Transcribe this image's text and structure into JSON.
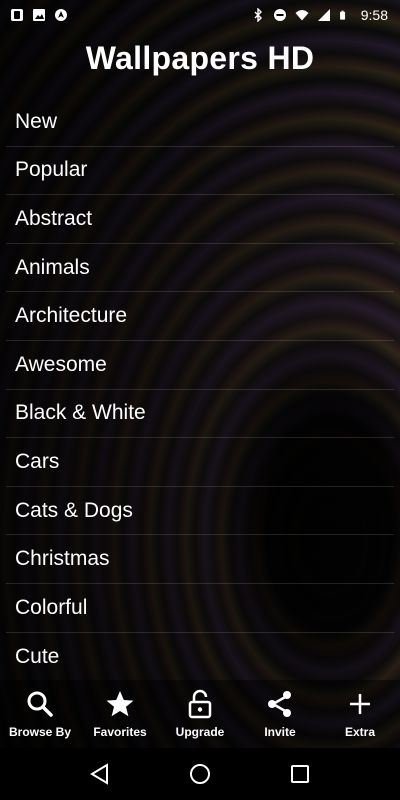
{
  "status_bar": {
    "time": "9:58",
    "left_icons": [
      "notification-app-icon",
      "image-icon",
      "navigation-icon"
    ],
    "right_icons": [
      "bluetooth-icon",
      "do-not-disturb-icon",
      "wifi-icon",
      "signal-icon",
      "battery-icon"
    ]
  },
  "header": {
    "title": "Wallpapers HD"
  },
  "categories": [
    "New",
    "Popular",
    "Abstract",
    "Animals",
    "Architecture",
    "Awesome",
    "Black & White",
    "Cars",
    "Cats & Dogs",
    "Christmas",
    "Colorful",
    "Cute"
  ],
  "tab_bar": {
    "tabs": [
      {
        "label": "Browse By",
        "icon": "search-icon"
      },
      {
        "label": "Favorites",
        "icon": "star-icon"
      },
      {
        "label": "Upgrade",
        "icon": "unlock-icon"
      },
      {
        "label": "Invite",
        "icon": "share-icon"
      },
      {
        "label": "Extra",
        "icon": "plus-icon"
      }
    ]
  },
  "nav_bar": {
    "buttons": [
      "back-icon",
      "home-icon",
      "recents-icon"
    ]
  }
}
